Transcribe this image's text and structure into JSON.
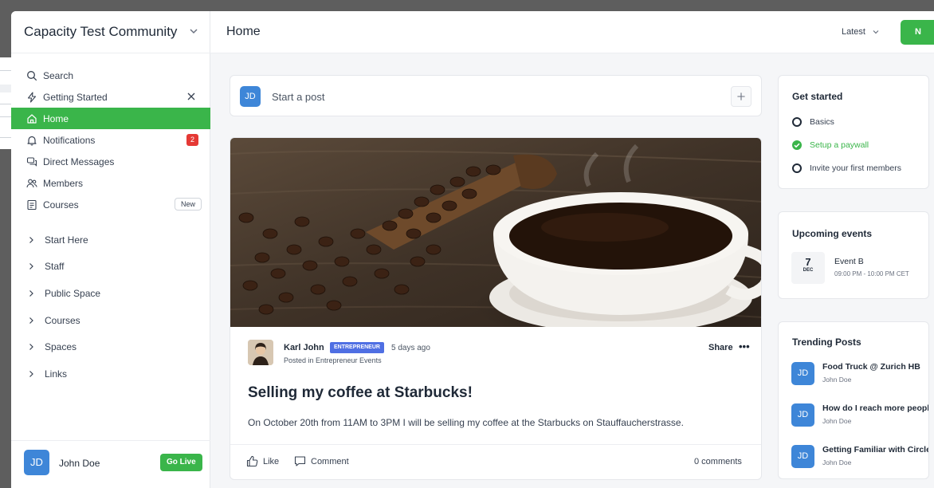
{
  "community": {
    "name": "Capacity Test Community"
  },
  "nav": {
    "items": [
      {
        "label": "Search",
        "icon": "search-icon"
      },
      {
        "label": "Getting Started",
        "icon": "bolt-icon"
      },
      {
        "label": "Home",
        "icon": "home-icon",
        "active": true
      },
      {
        "label": "Notifications",
        "icon": "bell-icon",
        "badge": "2"
      },
      {
        "label": "Direct Messages",
        "icon": "messages-icon"
      },
      {
        "label": "Members",
        "icon": "members-icon"
      },
      {
        "label": "Courses",
        "icon": "courses-icon",
        "tag": "New"
      }
    ],
    "groups": [
      "Start Here",
      "Staff",
      "Public Space",
      "Courses",
      "Spaces",
      "Links"
    ]
  },
  "user": {
    "initials": "JD",
    "name": "John Doe",
    "go_live_label": "Go Live"
  },
  "header": {
    "title": "Home",
    "sort_label": "Latest",
    "new_label": "N"
  },
  "composer": {
    "placeholder": "Start a post",
    "initials": "JD"
  },
  "post": {
    "author": "Karl John",
    "role": "ENTREPRENEUR",
    "time": "5 days ago",
    "posted_in": "Posted in Entrepreneur Events",
    "share_label": "Share",
    "more_label": "•••",
    "title": "Selling my coffee at Starbucks!",
    "body": "On October 20th from 11AM to 3PM I will be selling my coffee at the Starbucks on Stauffaucherstrasse.",
    "like_label": "Like",
    "comment_label": "Comment",
    "comments_count": "0 comments"
  },
  "get_started": {
    "title": "Get started",
    "items": [
      {
        "label": "Basics",
        "done": false
      },
      {
        "label": "Setup a paywall",
        "done": true
      },
      {
        "label": "Invite your first members",
        "done": false
      }
    ]
  },
  "events": {
    "title": "Upcoming events",
    "items": [
      {
        "day": "7",
        "month": "DEC",
        "name": "Event B",
        "time": "09:00 PM - 10:00 PM CET"
      }
    ]
  },
  "trending": {
    "title": "Trending Posts",
    "items": [
      {
        "initials": "JD",
        "title": "Food Truck @ Zurich HB",
        "author": "John Doe"
      },
      {
        "initials": "JD",
        "title": "How do I reach more people",
        "author": "John Doe"
      },
      {
        "initials": "JD",
        "title": "Getting Familiar with Circle",
        "author": "John Doe"
      }
    ]
  },
  "colors": {
    "accent": "#3ab54a",
    "avatar": "#3e86d8",
    "badge": "#e53935",
    "role": "#4f6fe3"
  }
}
